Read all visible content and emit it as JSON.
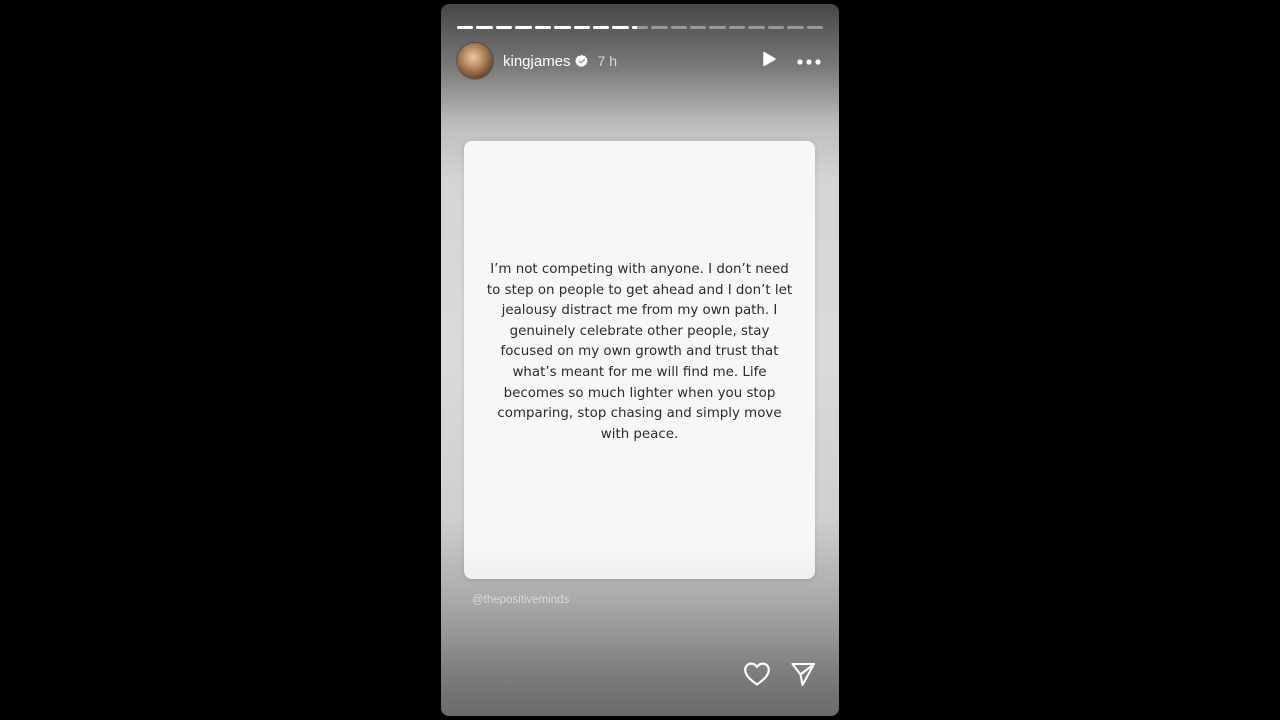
{
  "story": {
    "progress": {
      "segments_total": 19,
      "segments_complete": 9,
      "current_segment_fraction": 0.3
    },
    "header": {
      "username": "kingjames",
      "verified": true,
      "time_ago": "7 h",
      "play_icon": "play-icon",
      "more_icon": "more-options-icon"
    },
    "quote": "I’m not competing with anyone. I don’t need to step on people to get ahead and I don’t let jealousy distract me from my own path. I genuinely celebrate other people, stay focused on my own growth and trust that what’s meant for me will find me. Life becomes so much lighter when you stop comparing, stop chasing and simply move with peace.",
    "credit": "@thepositiveminds",
    "footer": {
      "like_icon": "heart-icon",
      "share_icon": "send-icon"
    }
  }
}
